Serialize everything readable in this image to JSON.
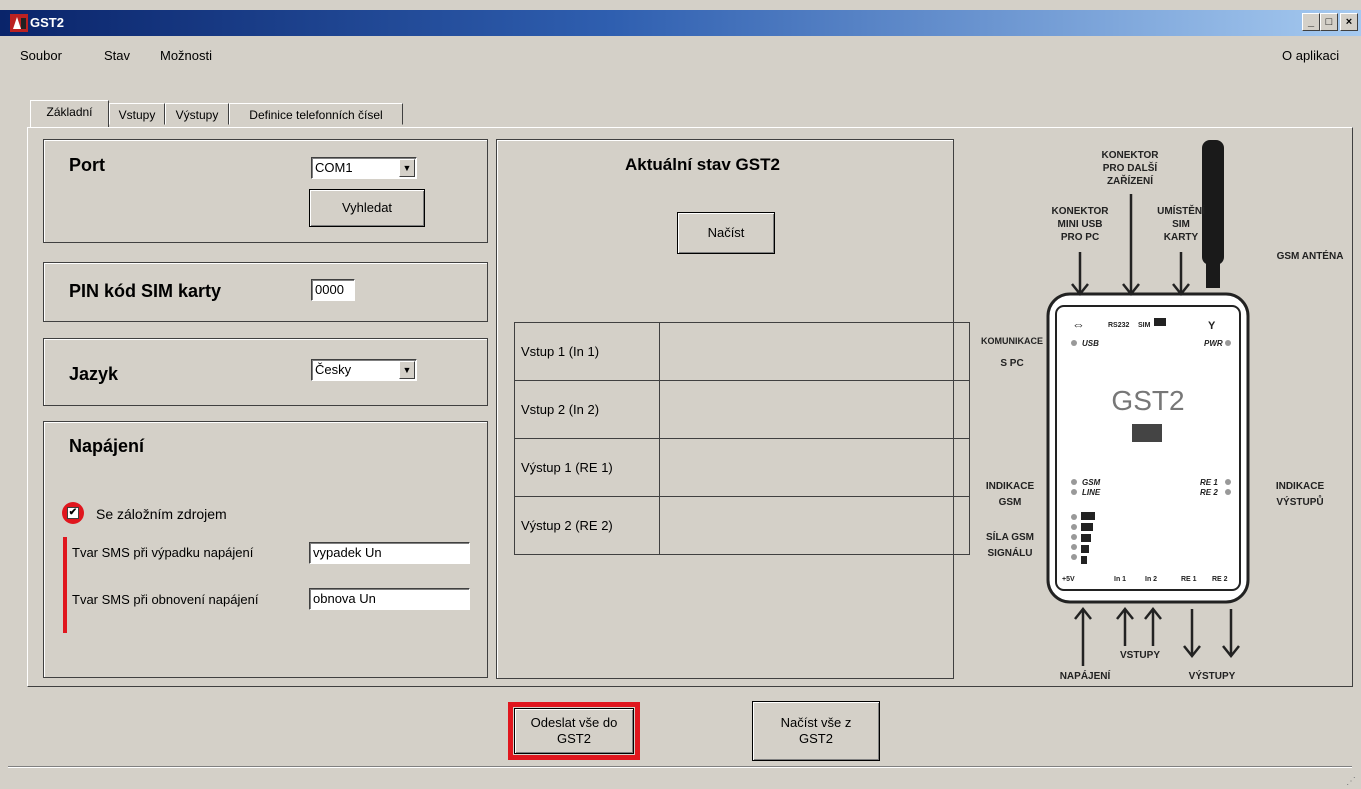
{
  "window": {
    "title": "GST2",
    "minimize": "_",
    "maximize": "□",
    "close": "×"
  },
  "menu": {
    "items": [
      "Soubor",
      "Stav",
      "Možnosti"
    ],
    "about": "O aplikaci"
  },
  "tabs": [
    "Základní",
    "Vstupy",
    "Výstupy",
    "Definice telefonních čísel"
  ],
  "port": {
    "title": "Port",
    "selected": "COM1",
    "search_label": "Vyhledat"
  },
  "pin": {
    "title": "PIN kód SIM karty",
    "value": "0000"
  },
  "language": {
    "title": "Jazyk",
    "selected": "Česky"
  },
  "power": {
    "title": "Napájení",
    "backup_label": "Se záložním zdrojem",
    "backup_checked": true,
    "sms_outage_label": "Tvar SMS při výpadku napájení",
    "sms_outage_value": "vypadek Un",
    "sms_restore_label": "Tvar SMS při obnovení napájení",
    "sms_restore_value": "obnova Un"
  },
  "status": {
    "title": "Aktuální stav GST2",
    "load_label": "Načíst",
    "rows": [
      {
        "label": "Vstup 1 (In 1)",
        "value": ""
      },
      {
        "label": "Vstup 2 (In 2)",
        "value": ""
      },
      {
        "label": "Výstup 1 (RE 1)",
        "value": ""
      },
      {
        "label": "Výstup 2 (RE 2)",
        "value": ""
      }
    ]
  },
  "diagram": {
    "connector_other": [
      "KONEKTOR",
      "PRO DALŠÍ",
      "ZAŘÍZENÍ"
    ],
    "connector_usb": [
      "KONEKTOR",
      "MINI USB",
      "PRO PC"
    ],
    "sim_location": [
      "UMÍSTĚNÍ",
      "SIM",
      "KARTY"
    ],
    "gsm_antenna": "GSM ANTÉNA",
    "pc_comm": [
      "KOMUNIKACE",
      "S PC"
    ],
    "gsm_indication": [
      "INDIKACE",
      "GSM"
    ],
    "signal_strength": [
      "SÍLA GSM",
      "SIGNÁLU"
    ],
    "output_indication": [
      "INDIKACE",
      "VÝSTUPŮ"
    ],
    "power": "NAPÁJENÍ",
    "inputs": "VSTUPY",
    "outputs": "VÝSTUPY",
    "device_name": "GST2",
    "device_top_labels": {
      "rs232": "RS232",
      "sim": "SIM"
    },
    "led_usb": "USB",
    "led_pwr": "PWR",
    "led_gsm": "GSM",
    "led_line": "LINE",
    "led_re1": "RE 1",
    "led_re2": "RE 2",
    "bottom_pins": [
      "+5V",
      "In 1",
      "In 2",
      "RE 1",
      "RE 2"
    ],
    "accent_color": "#e0161e"
  },
  "footer": {
    "send_label": "Odeslat vše do GST2",
    "load_label": "Načíst vše z GST2"
  }
}
